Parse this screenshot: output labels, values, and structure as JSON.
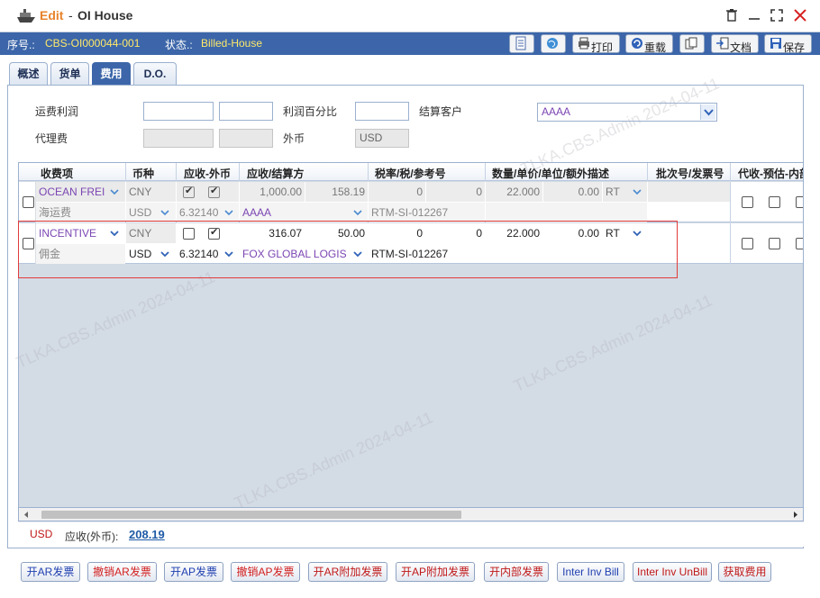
{
  "window": {
    "edit_label": "Edit",
    "sep": "-",
    "title": "OI House"
  },
  "info": {
    "no_label": "序号.:",
    "no_value": "CBS-OI000044-001",
    "status_label": "状态.:",
    "status_value": "Billed-House"
  },
  "toolbar": {
    "print": "打印",
    "reload": "重载",
    "docs": "文档",
    "save": "保存"
  },
  "tabs": [
    "概述",
    "货单",
    "费用",
    "D.O."
  ],
  "form": {
    "freight_profit_label": "运费利润",
    "profit_pct_label": "利润百分比",
    "settle_cust_label": "结算客户",
    "settle_cust_value": "AAAA",
    "agency_fee_label": "代理费",
    "fx_label": "外币",
    "fx_value": "USD"
  },
  "grid": {
    "headers": [
      "收费项",
      "币种",
      "应收-外币",
      "应收/结算方",
      "税率/税/参考号",
      "数量/单价/单位/额外描述",
      "批次号/发票号",
      "代收-预估-内部"
    ],
    "rows": [
      {
        "charge": "OCEAN FREI",
        "currency": "CNY",
        "amount": "1,000.00",
        "extra": "158.19",
        "tax_rate": "0",
        "tax": "0",
        "qty": "22.000",
        "price": "0.00",
        "unit": "RT",
        "charge_cn": "海运费",
        "fcur": "USD",
        "rate": "6.32140",
        "party": "AAAA",
        "ref": "RTM-SI-012267"
      },
      {
        "charge": "INCENTIVE",
        "currency": "CNY",
        "amount": "316.07",
        "extra": "50.00",
        "tax_rate": "0",
        "tax": "0",
        "qty": "22.000",
        "price": "0.00",
        "unit": "RT",
        "charge_cn": "佣金",
        "fcur": "USD",
        "rate": "6.32140",
        "party": "FOX GLOBAL LOGIS",
        "ref": "RTM-SI-012267"
      }
    ]
  },
  "summary": {
    "currency": "USD",
    "label": "应收(外币):",
    "value": "208.19"
  },
  "buttons": [
    "开AR发票",
    "撤销AR发票",
    "开AP发票",
    "撤销AP发票",
    "开AR附加发票",
    "开AP附加发票",
    "开内部发票",
    "Inter Inv Bill",
    "Inter Inv UnBill",
    "获取费用"
  ],
  "watermark": "TLKA.CBS.Admin 2024-04-11",
  "colors": {
    "header_blue": "#3c66a9",
    "edit_orange": "#e8832b",
    "status_yellow": "#ffe86a",
    "highlight_red": "#e23b3b"
  }
}
